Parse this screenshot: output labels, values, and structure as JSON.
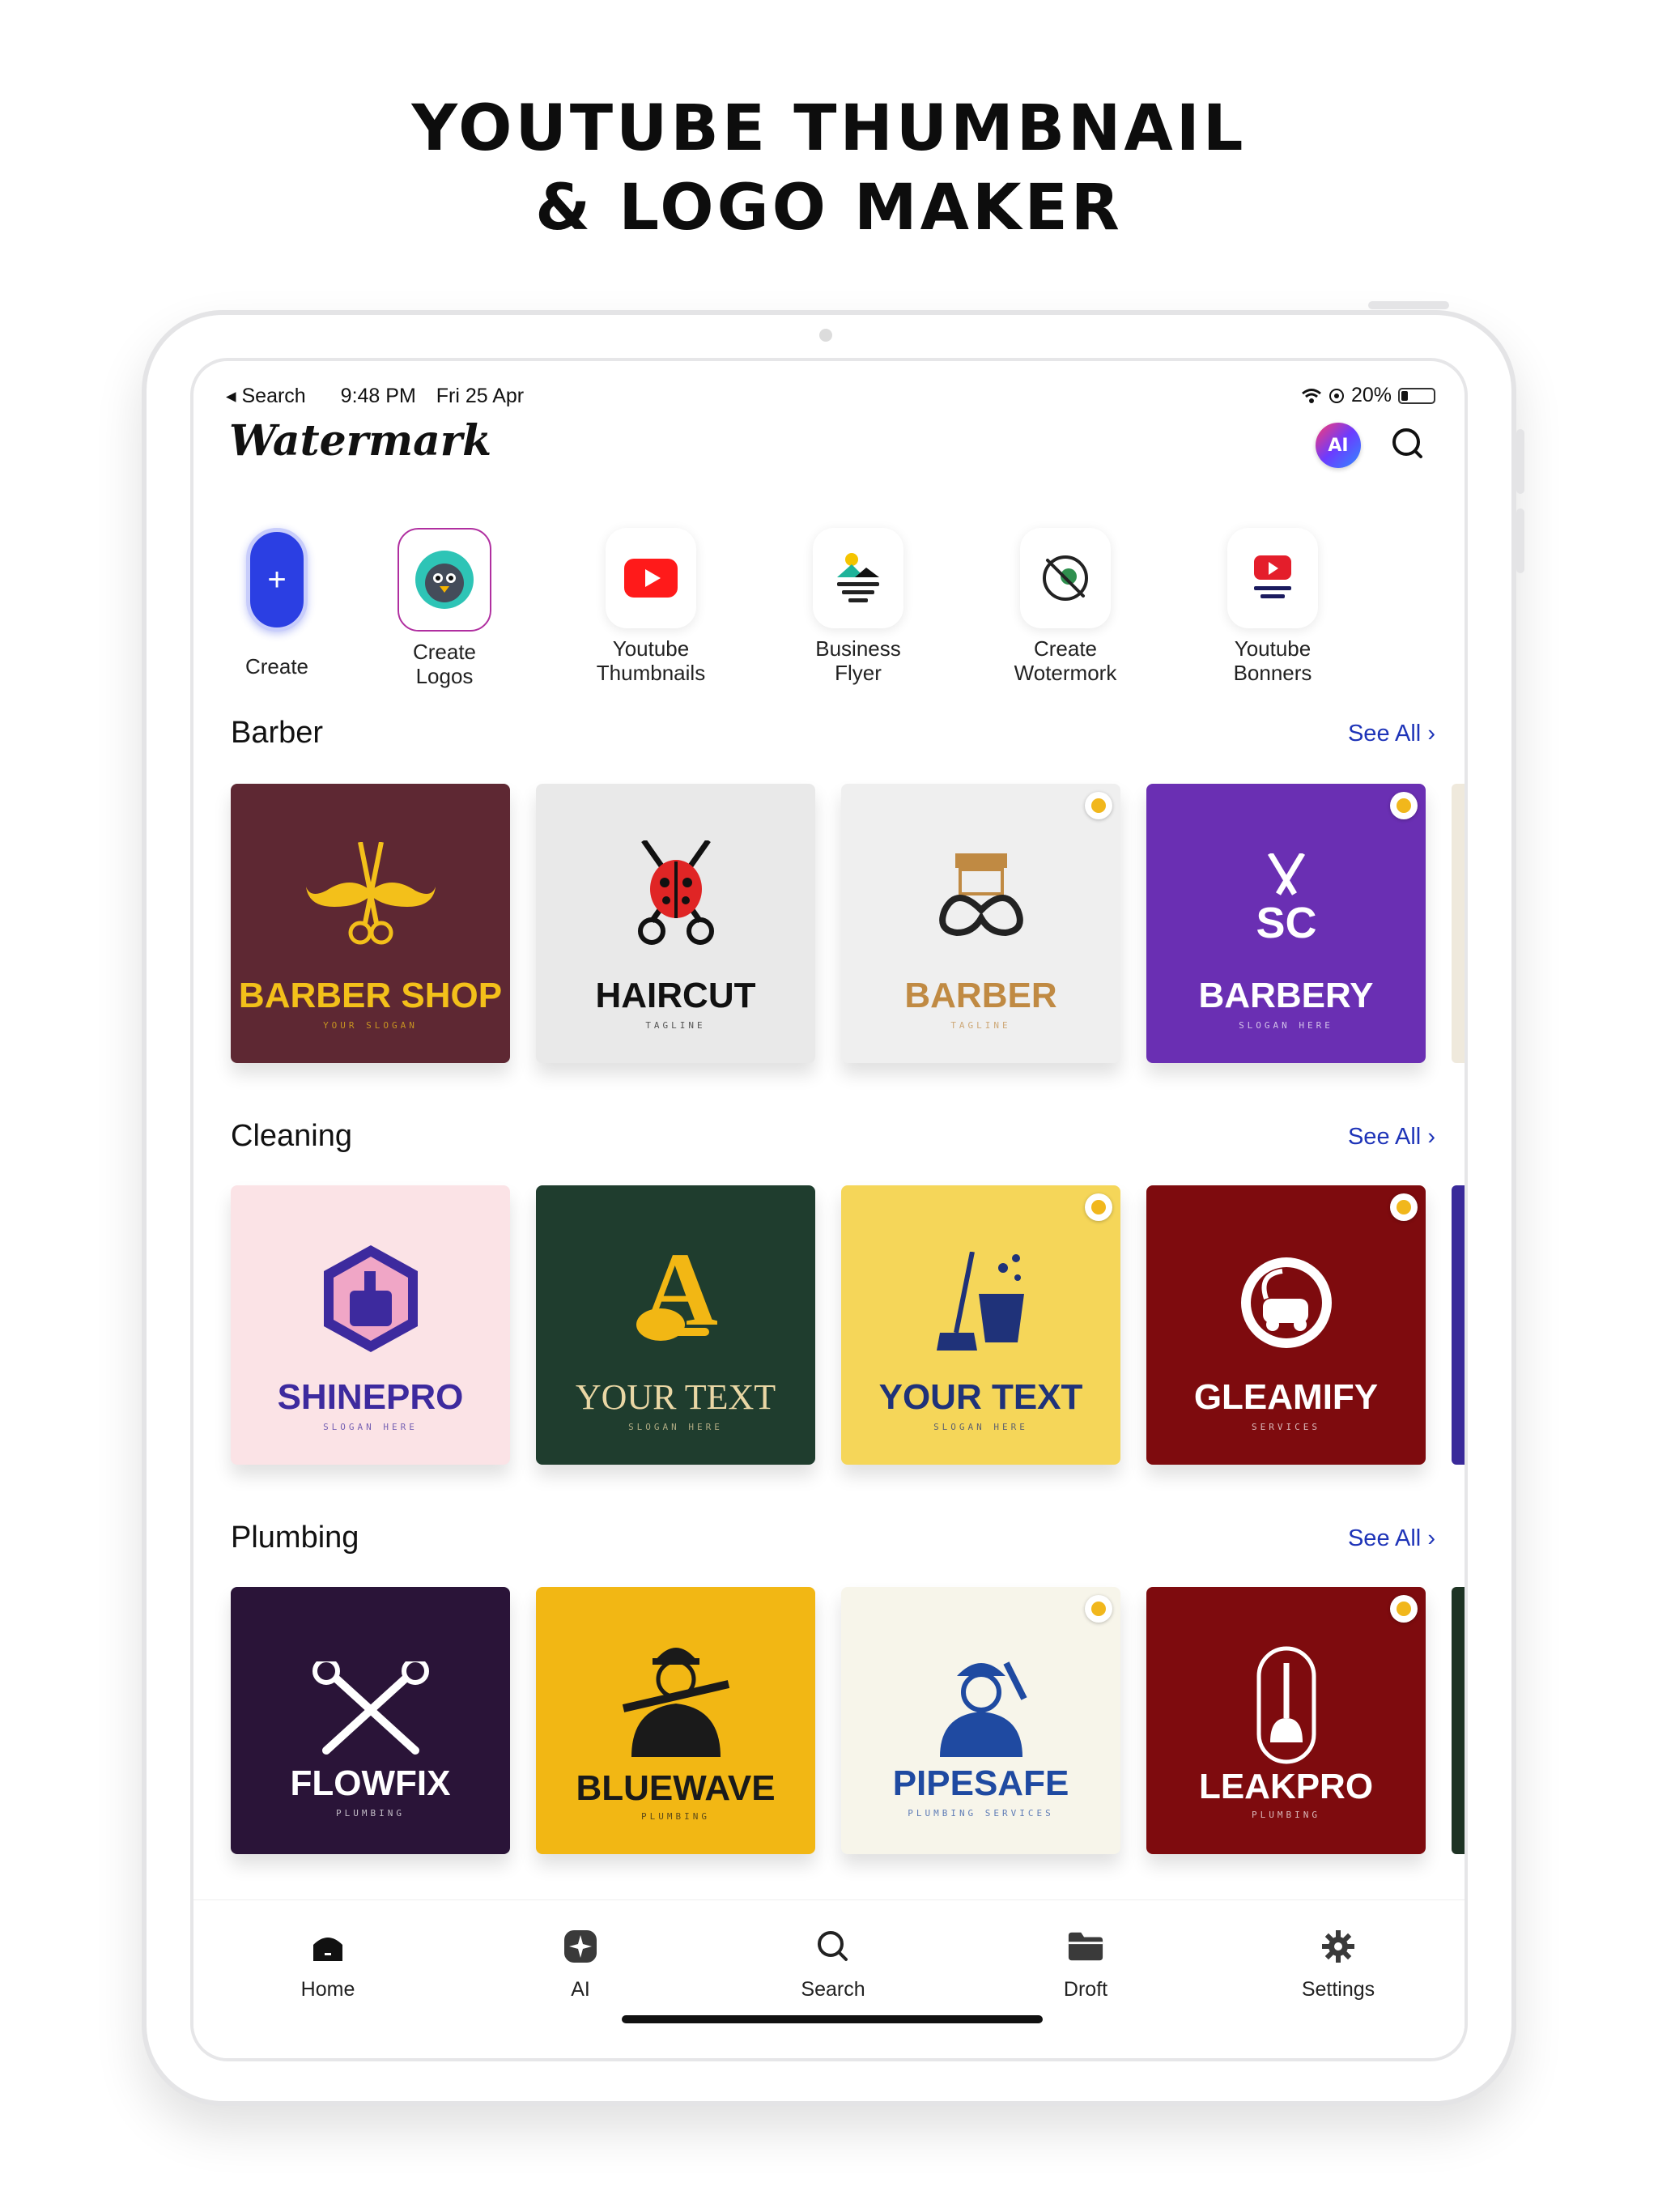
{
  "headline": {
    "line1": "YOUTUBE THUMBNAIL",
    "line2": "& LOGO MAKER"
  },
  "status_bar": {
    "back_label": "Search",
    "time": "9:48 PM",
    "date": "Fri 25 Apr",
    "battery": "20%",
    "battery_level": 0.2
  },
  "app": {
    "brand": "Watermark",
    "ai_badge": "AI"
  },
  "quick_actions": [
    {
      "label_1": "Create",
      "label_2": "",
      "icon": "plus-icon"
    },
    {
      "label_1": "Create",
      "label_2": "Logos",
      "icon": "bird-logo-icon"
    },
    {
      "label_1": "Youtube",
      "label_2": "Thumbnails",
      "icon": "youtube-play-icon"
    },
    {
      "label_1": "Business",
      "label_2": "Flyer",
      "icon": "flyer-icon"
    },
    {
      "label_1": "Create",
      "label_2": "Wotermork",
      "icon": "no-watermark-icon"
    },
    {
      "label_1": "Youtube",
      "label_2": "Bonners",
      "icon": "youtube-banner-icon"
    }
  ],
  "sections": [
    {
      "title": "Barber",
      "see_all": "See All",
      "cards": [
        {
          "title": "BARBER SHOP",
          "slogan": "YOUR SLOGAN",
          "bg": "#5e2833",
          "color": "#f3c01a",
          "locked": false
        },
        {
          "title": "HAIRCUT",
          "slogan": "TAGLINE",
          "bg": "#e9e9e9",
          "color": "#111111",
          "locked": false
        },
        {
          "title": "BARBER",
          "slogan": "TAGLINE",
          "bg": "#efefef",
          "color": "#c08a43",
          "locked": true
        },
        {
          "title": "BARBERY",
          "slogan": "SLOGAN HERE",
          "bg": "#6a2fb3",
          "color": "#ffffff",
          "locked": true
        }
      ]
    },
    {
      "title": "Cleaning",
      "see_all": "See All",
      "cards": [
        {
          "title": "SHINEPRO",
          "slogan": "SLOGAN HERE",
          "bg": "#fbe3e6",
          "color": "#3d2a9e",
          "locked": false
        },
        {
          "title": "YOUR TEXT",
          "slogan": "SLOGAN HERE",
          "bg": "#1f3d2e",
          "color": "#ead7a5",
          "locked": false
        },
        {
          "title": "YOUR TEXT",
          "slogan": "SLOGAN HERE",
          "bg": "#f5d659",
          "color": "#1f3279",
          "locked": true
        },
        {
          "title": "GLEAMIFY",
          "slogan": "SERVICES",
          "bg": "#7e0b0e",
          "color": "#ffffff",
          "locked": true
        }
      ]
    },
    {
      "title": "Plumbing",
      "see_all": "See All",
      "cards": [
        {
          "title": "FLOWFIX",
          "slogan": "PLUMBING",
          "bg": "#2a1438",
          "color": "#ffffff",
          "locked": false
        },
        {
          "title": "BLUEWAVE",
          "slogan": "PLUMBING",
          "bg": "#f2b714",
          "color": "#1a1a1a",
          "locked": false
        },
        {
          "title": "PIPESAFE",
          "slogan": "PLUMBING SERVICES",
          "bg": "#f7f5ea",
          "color": "#1f4aa1",
          "locked": true
        },
        {
          "title": "LEAKPRO",
          "slogan": "PLUMBING",
          "bg": "#7e0b0e",
          "color": "#ffffff",
          "locked": true
        }
      ]
    }
  ],
  "tabs": [
    {
      "label": "Home",
      "icon": "home-icon"
    },
    {
      "label": "AI",
      "icon": "ai-sparkle-icon"
    },
    {
      "label": "Search",
      "icon": "search-icon"
    },
    {
      "label": "Droft",
      "icon": "folder-icon"
    },
    {
      "label": "Settings",
      "icon": "gear-icon"
    }
  ]
}
